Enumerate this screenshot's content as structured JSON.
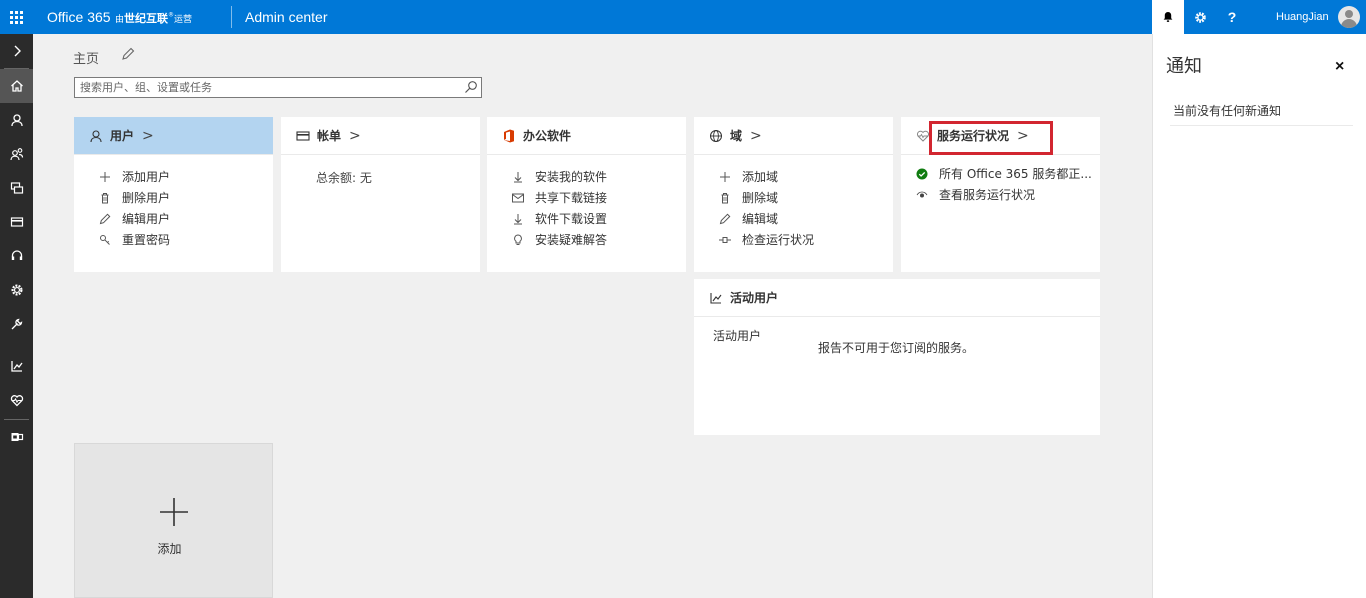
{
  "header": {
    "brand_main": "Office 365",
    "brand_by": "由",
    "brand_company": "世纪互联",
    "brand_mark": "®",
    "brand_operated": "运营",
    "app_title": "Admin center",
    "help_label": "?",
    "user_name": "HuangJian"
  },
  "left_nav": {
    "items": [
      "expand-icon",
      "home-icon",
      "user-icon",
      "groups-icon",
      "resources-icon",
      "billing-icon",
      "support-icon",
      "settings-icon",
      "setup-icon",
      "reports-icon",
      "health-icon",
      "admin-centers-icon"
    ]
  },
  "main": {
    "breadcrumb": "主页",
    "search_placeholder": "搜索用户、组、设置或任务",
    "cards": {
      "users": {
        "title": "用户",
        "chevron": ">",
        "items": [
          "添加用户",
          "删除用户",
          "编辑用户",
          "重置密码"
        ]
      },
      "billing": {
        "title": "帐单",
        "chevron": ">",
        "balance": "总余额: 无"
      },
      "office": {
        "title": "办公软件",
        "items": [
          "安装我的软件",
          "共享下载链接",
          "软件下载设置",
          "安装疑难解答"
        ]
      },
      "domains": {
        "title": "域",
        "chevron": ">",
        "items": [
          "添加域",
          "删除域",
          "编辑域",
          "检查运行状况"
        ]
      },
      "health": {
        "title": "服务运行状况",
        "chevron": ">",
        "items": [
          "所有 Office 365 服务都正...",
          "查看服务运行状况"
        ]
      },
      "active_users": {
        "title": "活动用户",
        "label": "活动用户",
        "message": "报告不可用于您订阅的服务。"
      }
    },
    "add_tile_label": "添加"
  },
  "notifications": {
    "title": "通知",
    "close": "×",
    "message": "当前没有任何新通知"
  },
  "colors": {
    "topbar": "#0078d7",
    "leftnav": "#2b2b2b",
    "selected_card_header": "#b3d4f0",
    "highlight": "#d22630",
    "status_ok": "#107c10"
  }
}
